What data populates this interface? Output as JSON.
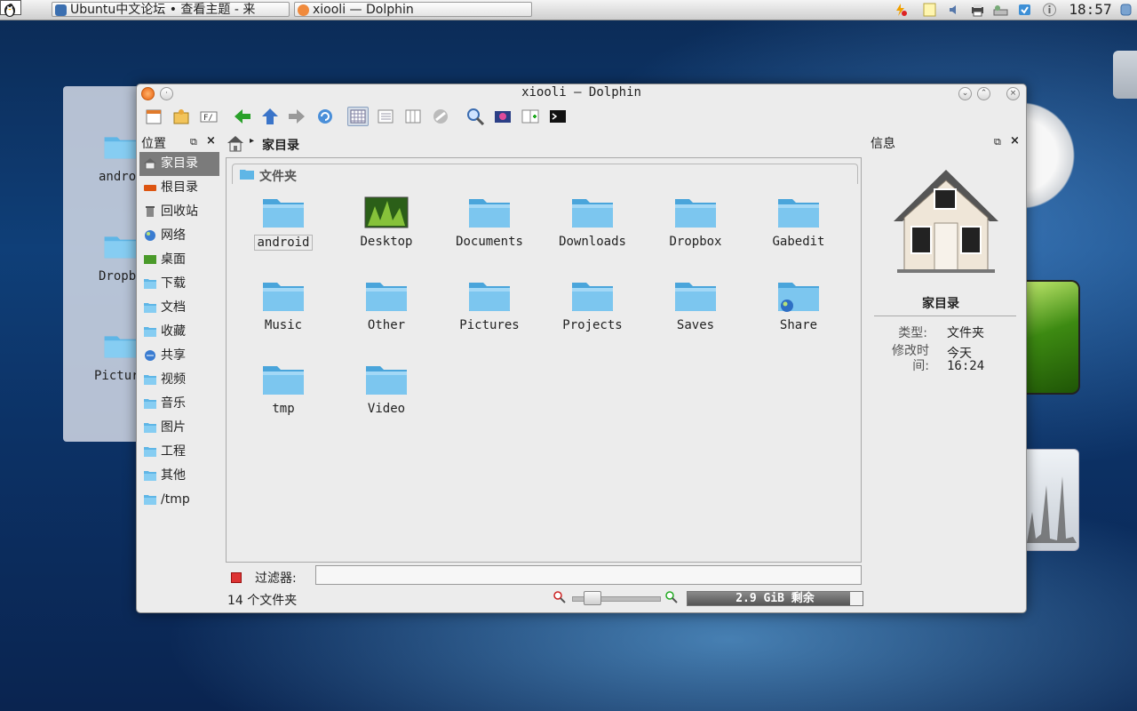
{
  "taskbar": {
    "desktop_number": "0",
    "tasks": [
      {
        "label": "Ubuntu中文论坛 • 查看主题 - 来"
      },
      {
        "label": "xiooli — Dolphin"
      }
    ],
    "clock": "18:57"
  },
  "desktop": {
    "items": [
      {
        "label": "android"
      },
      {
        "label": "Dropbox"
      },
      {
        "label": "Pictures"
      }
    ]
  },
  "window": {
    "title": "xiooli — Dolphin"
  },
  "places": {
    "header": "位置",
    "items": [
      {
        "label": "家目录",
        "icon": "home-icon"
      },
      {
        "label": "根目录",
        "icon": "root-icon"
      },
      {
        "label": "回收站",
        "icon": "trash-icon"
      },
      {
        "label": "网络",
        "icon": "network-icon"
      },
      {
        "label": "桌面",
        "icon": "desktop-icon"
      },
      {
        "label": "下载",
        "icon": "folder-icon"
      },
      {
        "label": "文档",
        "icon": "folder-icon"
      },
      {
        "label": "收藏",
        "icon": "folder-icon"
      },
      {
        "label": "共享",
        "icon": "share-icon"
      },
      {
        "label": "视频",
        "icon": "folder-icon"
      },
      {
        "label": "音乐",
        "icon": "folder-icon"
      },
      {
        "label": "图片",
        "icon": "folder-icon"
      },
      {
        "label": "工程",
        "icon": "folder-icon"
      },
      {
        "label": "其他",
        "icon": "folder-icon"
      },
      {
        "label": "/tmp",
        "icon": "folder-icon"
      }
    ]
  },
  "breadcrumb": {
    "current": "家目录"
  },
  "view": {
    "group_label": "文件夹",
    "files": [
      {
        "name": "android"
      },
      {
        "name": "Desktop"
      },
      {
        "name": "Documents"
      },
      {
        "name": "Downloads"
      },
      {
        "name": "Dropbox"
      },
      {
        "name": "Gabedit"
      },
      {
        "name": "Music"
      },
      {
        "name": "Other"
      },
      {
        "name": "Pictures"
      },
      {
        "name": "Projects"
      },
      {
        "name": "Saves"
      },
      {
        "name": "Share"
      },
      {
        "name": "tmp"
      },
      {
        "name": "Video"
      }
    ]
  },
  "filter": {
    "label": "过滤器:",
    "value": ""
  },
  "status": {
    "text": "14 个文件夹",
    "free_space": "2.9 GiB 剩余",
    "disk_used_fraction": 0.93
  },
  "info": {
    "header": "信息",
    "name": "家目录",
    "type_key": "类型:",
    "type_value": "文件夹",
    "modified_key": "修改时间:",
    "modified_date": "今天",
    "modified_time": "16:24"
  },
  "colors": {
    "folder": "#5fb6e6",
    "selected_place": "#7b7b7b"
  }
}
